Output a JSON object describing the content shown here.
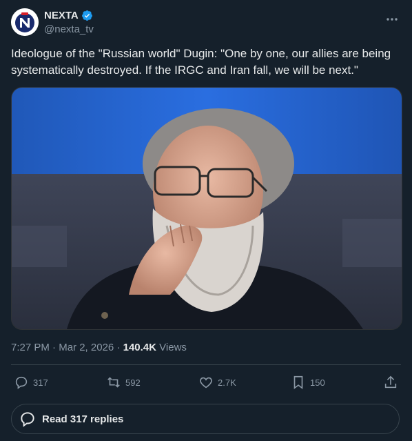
{
  "account": {
    "display_name": "NEXTA",
    "handle": "@nexta_tv",
    "verified": true,
    "avatar_letter": "N"
  },
  "tweet": {
    "text": "Ideologue of the \"Russian world\" Dugin: \"One by one, our allies are being systematically destroyed. If the IRGC and Iran fall, we will be next.\"",
    "time": "7:27 PM",
    "date": "Mar 2, 2026",
    "separator": "·",
    "views_count": "140.4K",
    "views_label": "Views"
  },
  "actions": {
    "replies": "317",
    "retweets": "592",
    "likes": "2.7K",
    "bookmarks": "150"
  },
  "read_replies_label": "Read 317 replies",
  "icons": {
    "more": "more-icon",
    "verified": "verified-badge-icon",
    "reply": "reply-icon",
    "retweet": "retweet-icon",
    "like": "heart-icon",
    "bookmark": "bookmark-icon",
    "share": "share-icon"
  },
  "colors": {
    "background": "#15202b",
    "text": "#e7e9ea",
    "secondary": "#8b98a5",
    "verified": "#1d9bf0",
    "brand_red": "#d8202a"
  }
}
